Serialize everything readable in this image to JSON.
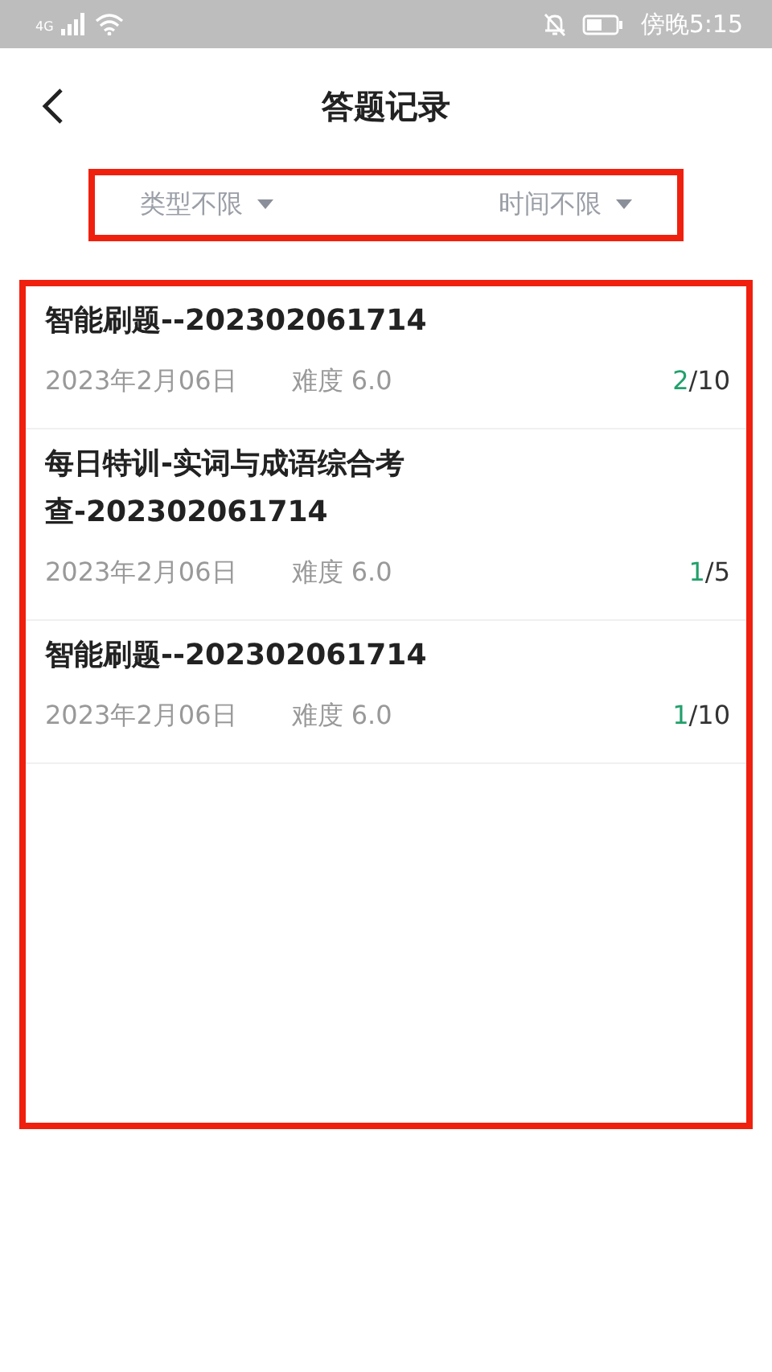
{
  "status_bar": {
    "network": "4G",
    "time": "傍晚5:15"
  },
  "header": {
    "title": "答题记录"
  },
  "filters": [
    {
      "label": "类型不限"
    },
    {
      "label": "时间不限"
    }
  ],
  "records": [
    {
      "title": "智能刷题--202302061714",
      "date": "2023年2月06日",
      "difficulty": "难度 6.0",
      "correct": "2",
      "total": "/10"
    },
    {
      "title": "每日特训-实词与成语综合考查-202302061714",
      "date": "2023年2月06日",
      "difficulty": "难度 6.0",
      "correct": "1",
      "total": "/5"
    },
    {
      "title": "智能刷题--202302061714",
      "date": "2023年2月06日",
      "difficulty": "难度 6.0",
      "correct": "1",
      "total": "/10"
    }
  ]
}
